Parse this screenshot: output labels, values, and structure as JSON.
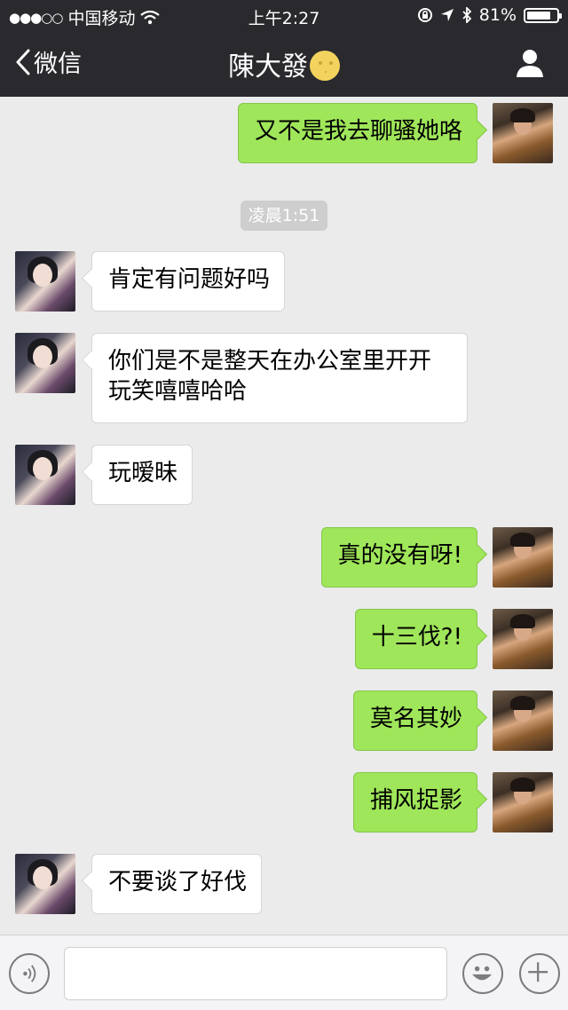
{
  "status_bar": {
    "signal_dots": "●●●○○",
    "carrier": "中国移动",
    "time": "上午2:27",
    "battery": "81%",
    "battery_level": 0.81
  },
  "nav": {
    "back_label": "微信",
    "title": "陳大發",
    "title_emoji": "moon-face-icon",
    "profile_icon": "person-icon"
  },
  "messages": [
    {
      "side": "out",
      "text": "又不是我去聊骚她咯"
    },
    {
      "type": "timestamp",
      "text": "凌晨1:51"
    },
    {
      "side": "in",
      "text": "肯定有问题好吗"
    },
    {
      "side": "in",
      "text_line1": "你们是不是整天在办公室里开开",
      "text_line2": "玩笑嘻嘻哈哈"
    },
    {
      "side": "in",
      "text": "玩暧昧"
    },
    {
      "side": "out",
      "text": "真的没有呀!"
    },
    {
      "side": "out",
      "text": "十三伐?!"
    },
    {
      "side": "out",
      "text": "莫名其妙"
    },
    {
      "side": "out",
      "text": "捕风捉影"
    },
    {
      "side": "in",
      "text": "不要谈了好伐"
    }
  ],
  "input_bar": {
    "voice_icon": "voice-icon",
    "emoji_icon": "emoji-icon",
    "plus_icon": "plus-icon",
    "text_value": ""
  }
}
